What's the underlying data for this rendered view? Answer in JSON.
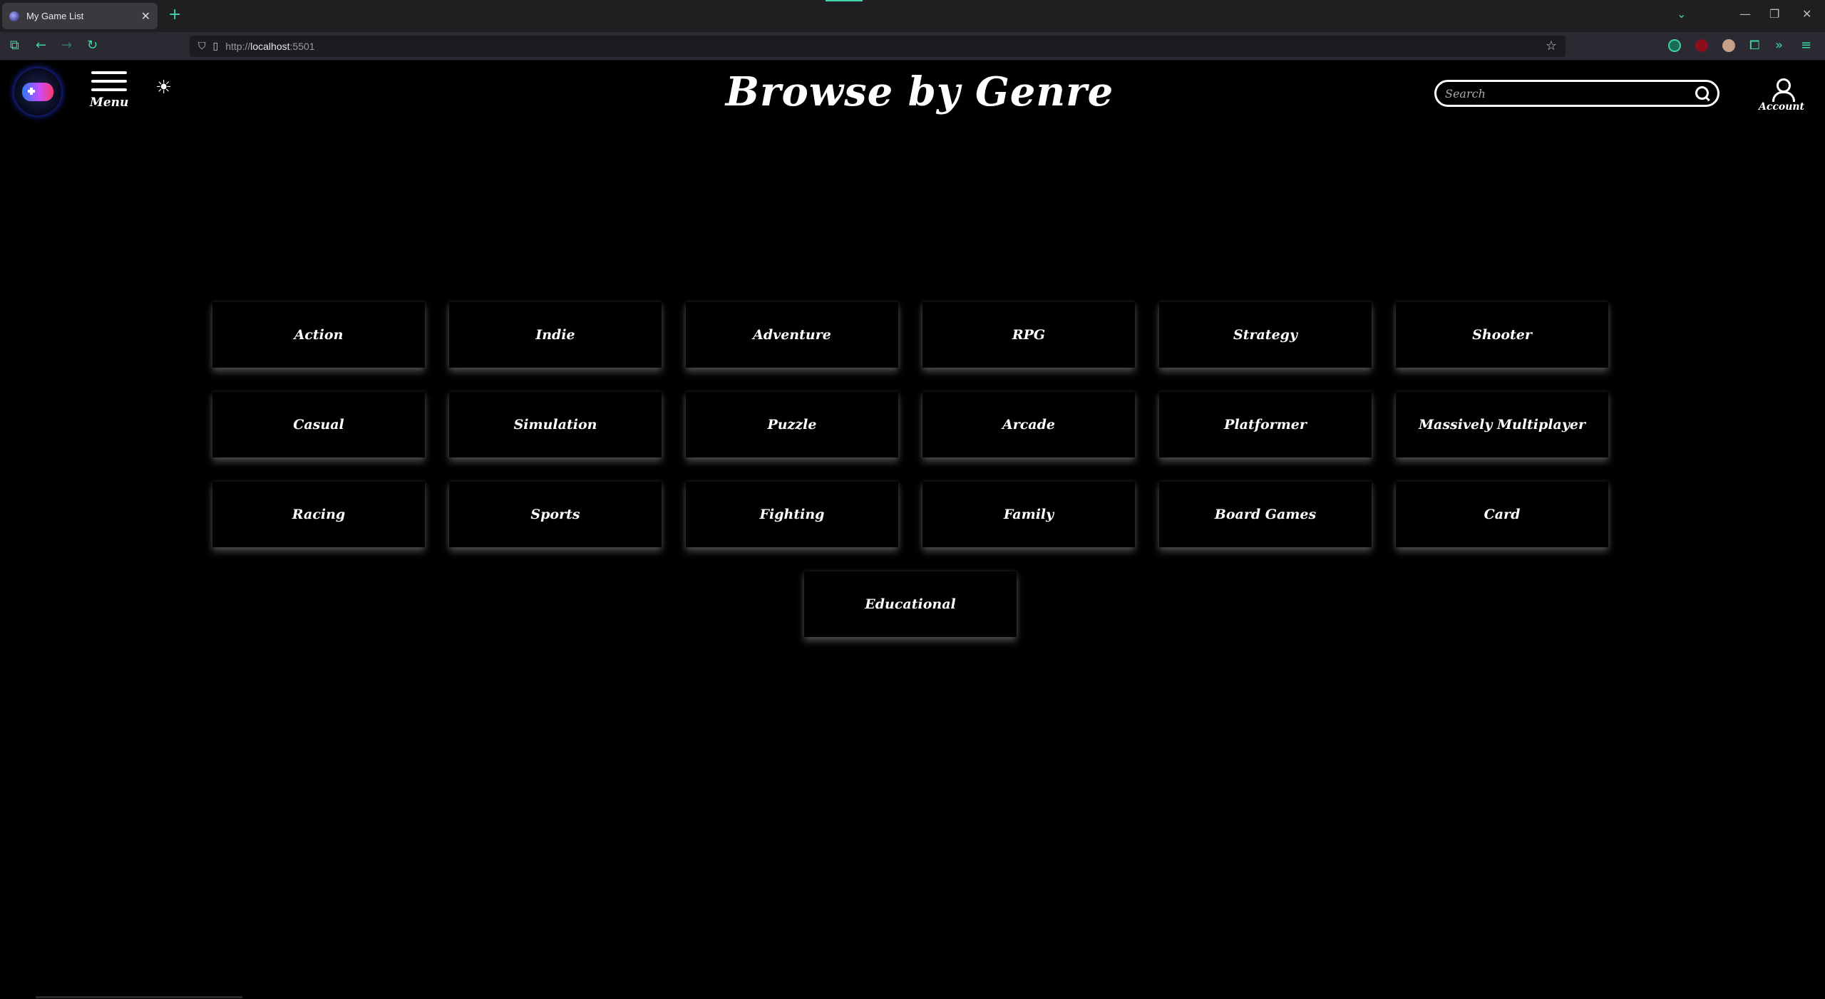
{
  "browser": {
    "tab_title": "My Game List",
    "url_prefix": "http://",
    "url_host": "localhost",
    "url_suffix": ":5501"
  },
  "header": {
    "menu_label": "Menu",
    "title": "Browse by Genre",
    "search_placeholder": "Search",
    "account_label": "Account"
  },
  "genres": [
    "Action",
    "Indie",
    "Adventure",
    "RPG",
    "Strategy",
    "Shooter",
    "Casual",
    "Simulation",
    "Puzzle",
    "Arcade",
    "Platformer",
    "Massively Multiplayer",
    "Racing",
    "Sports",
    "Fighting",
    "Family",
    "Board Games",
    "Card",
    "Educational"
  ],
  "colors": {
    "accent": "#3ed6a8",
    "background": "#000000"
  }
}
